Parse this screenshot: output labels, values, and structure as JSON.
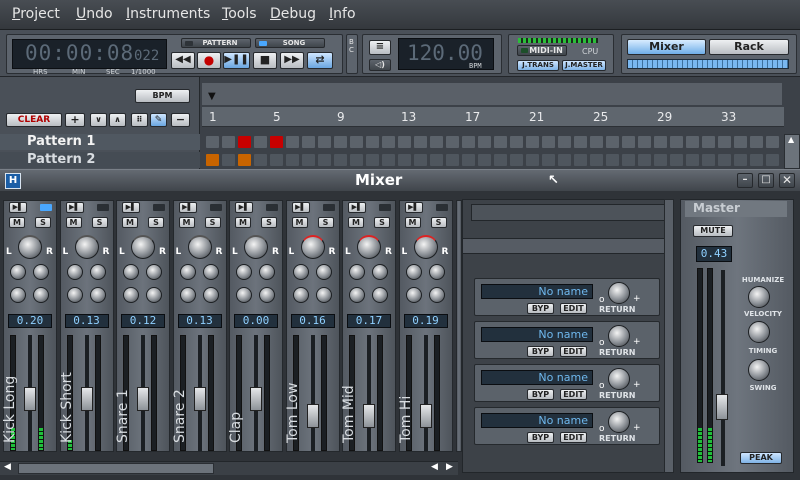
{
  "menu": [
    "Project",
    "Undo",
    "Instruments",
    "Tools",
    "Debug",
    "Info"
  ],
  "transport": {
    "time": "00:00:08",
    "time_ms": "022",
    "time_labels": [
      "HRS",
      "MIN",
      "SEC",
      "1/1000"
    ],
    "mode_pattern": "PATTERN",
    "mode_song": "SONG",
    "bc_label": "B C",
    "bpm_value": "120.00",
    "bpm_label": "BPM",
    "midi_in": "MIDI-IN",
    "cpu": "CPU",
    "j_trans": "J.TRANS",
    "j_master": "J.MASTER",
    "mixer_button": "Mixer",
    "rack_button": "Rack"
  },
  "song_editor": {
    "bpm_button": "BPM",
    "clear_button": "CLEAR",
    "tool_plus": "+",
    "tool_minus": "−",
    "ruler_labels": [
      "1",
      "5",
      "9",
      "13",
      "17",
      "21",
      "25",
      "29",
      "33"
    ],
    "patterns": [
      {
        "name": "Pattern 1",
        "active_cells": [
          2,
          4
        ]
      },
      {
        "name": "Pattern 2",
        "active_cells": [
          0,
          2
        ]
      }
    ],
    "colors": {
      "pattern1_cell": "#c80000",
      "pattern2_cell": "#c86400"
    }
  },
  "mixer": {
    "title": "Mixer",
    "strips": [
      {
        "name": "Kick Long",
        "volume": "0.20",
        "level": 0.45
      },
      {
        "name": "Kick Short",
        "volume": "0.13",
        "level": 0.45
      },
      {
        "name": "Snare 1",
        "volume": "0.12",
        "level": 0.45
      },
      {
        "name": "Snare 2",
        "volume": "0.13",
        "level": 0.45
      },
      {
        "name": "Clap",
        "volume": "0.00",
        "level": 0.45
      },
      {
        "name": "Tom Low",
        "volume": "0.16",
        "level": 0.3
      },
      {
        "name": "Tom Mid",
        "volume": "0.17",
        "level": 0.3
      },
      {
        "name": "Tom Hi",
        "volume": "0.19",
        "level": 0.3
      }
    ],
    "mute_label": "M",
    "solo_label": "S",
    "pan_left": "L",
    "pan_right": "R",
    "fx": [
      {
        "name": "No name",
        "bypass": "BYP",
        "edit": "EDIT",
        "return": "RETURN"
      },
      {
        "name": "No name",
        "bypass": "BYP",
        "edit": "EDIT",
        "return": "RETURN"
      },
      {
        "name": "No name",
        "bypass": "BYP",
        "edit": "EDIT",
        "return": "RETURN"
      },
      {
        "name": "No name",
        "bypass": "BYP",
        "edit": "EDIT",
        "return": "RETURN"
      }
    ],
    "master": {
      "title": "Master",
      "mute": "MUTE",
      "volume": "0.43",
      "humanize": "HUMANIZE",
      "velocity": "VELOCITY",
      "timing": "TIMING",
      "swing": "SWING",
      "peak": "PEAK"
    }
  }
}
